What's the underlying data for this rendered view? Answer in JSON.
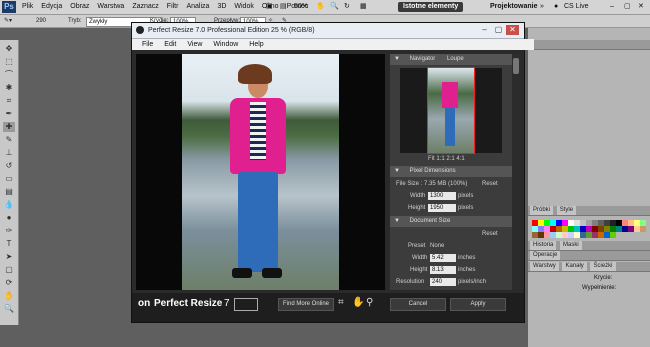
{
  "ps": {
    "menus": [
      "Plik",
      "Edycja",
      "Obraz",
      "Warstwa",
      "Zaznacz",
      "Filtr",
      "Analiza",
      "3D",
      "Widok",
      "Okno",
      "Pomoc"
    ],
    "zoom": "50%",
    "essentials": "Istotne elementy",
    "design": "Projektowanie",
    "cslive": "CS Live",
    "opt_mode_label": "Tryb:",
    "opt_mode_value": "Zwykły",
    "opt_kryc_label": "Krycie:",
    "opt_kryc_value": "100%",
    "opt_przep_label": "Przepływ:",
    "opt_przep_value": "100%",
    "brush_size": "290",
    "panel_probki": "Próbki",
    "panel_style": "Style",
    "panel_historia": "Historia",
    "panel_maski": "Maski",
    "panel_operacje": "Operacje",
    "panel_warstwy": "Warstwy",
    "panel_kanaly": "Kanały",
    "panel_sciezki": "Ścieżki",
    "panel_kryc": "Krycie:",
    "panel_wypel": "Wypełnienie:",
    "swatch_colors": [
      "#ff0000",
      "#ffff00",
      "#00ff00",
      "#00ffff",
      "#0000ff",
      "#ff00ff",
      "#ffffff",
      "#e0e0e0",
      "#c0c0c0",
      "#a0a0a0",
      "#808080",
      "#606060",
      "#404040",
      "#202020",
      "#000000",
      "#ff8080",
      "#ffc080",
      "#ffff80",
      "#80ff80",
      "#80ffff",
      "#8080ff",
      "#ff80ff",
      "#c00000",
      "#c06000",
      "#c0c000",
      "#00c000",
      "#00c0c0",
      "#0000c0",
      "#c000c0",
      "#800000",
      "#804000",
      "#808000",
      "#008000",
      "#008080",
      "#000080",
      "#800080",
      "#ffcc99",
      "#cc9966",
      "#996633",
      "#663300",
      "#ff9999",
      "#99ccff",
      "#ccffcc",
      "#ffcccc",
      "#ccccff",
      "#ffffcc",
      "#336699",
      "#669933",
      "#993366",
      "#cc6600",
      "#0066cc",
      "#66cc00"
    ]
  },
  "window": {
    "title": "Perfect Resize 7.0 Professional Edition  25 % (RGB/8)",
    "menus": [
      "File",
      "Edit",
      "View",
      "Window",
      "Help"
    ]
  },
  "navigator": {
    "tab1": "Navigator",
    "tab2": "Loupe",
    "zoom_options": "Fit  1:1  2:1  4:1"
  },
  "pixel_dims": {
    "title": "Pixel Dimensions",
    "file_size": "File Size : 7.35 MB (100%)",
    "reset": "Reset",
    "width_label": "Width",
    "width_value": "1300",
    "width_unit": "pixels",
    "height_label": "Height",
    "height_value": "1950",
    "height_unit": "pixels"
  },
  "doc_size": {
    "title": "Document Size",
    "reset": "Reset",
    "preset_label": "Preset",
    "preset_value": "None",
    "width_label": "Width",
    "width_value": "5.42",
    "width_unit": "inches",
    "height_label": "Height",
    "height_value": "8.13",
    "height_unit": "inches",
    "resolution_label": "Resolution",
    "resolution_value": "240",
    "resolution_unit": "pixels/inch"
  },
  "bottom": {
    "logo": "Perfect Resize",
    "version": "7",
    "find_more": "Find More Online",
    "cancel": "Cancel",
    "apply": "Apply"
  }
}
